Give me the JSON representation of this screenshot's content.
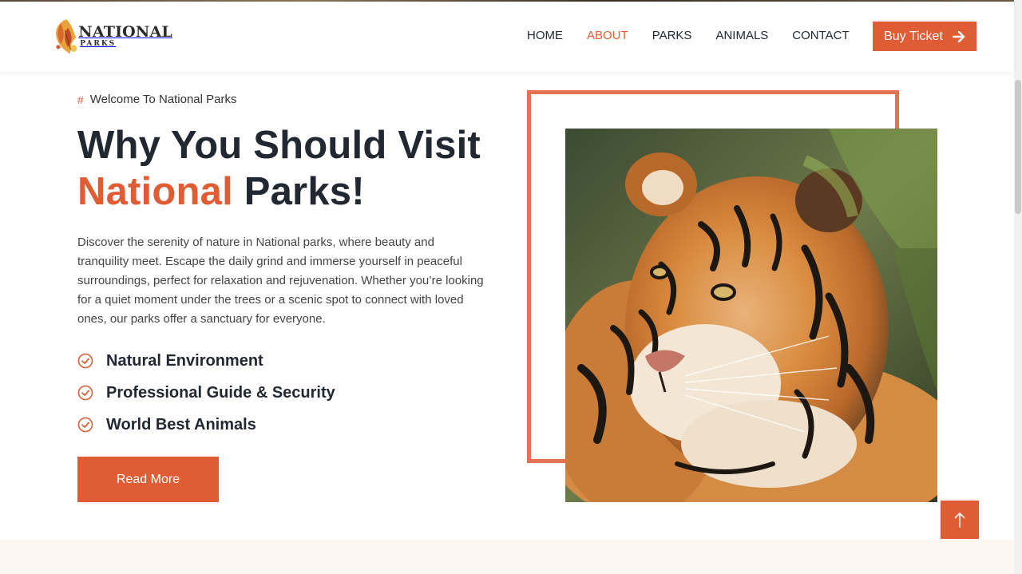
{
  "brand": {
    "title": "NATIONAL",
    "subtitle": "PARKS",
    "accent_color": "#e05c35"
  },
  "nav": {
    "items": [
      {
        "label": "HOME",
        "active": false
      },
      {
        "label": "ABOUT",
        "active": true
      },
      {
        "label": "PARKS",
        "active": false
      },
      {
        "label": "ANIMALS",
        "active": false
      },
      {
        "label": "CONTACT",
        "active": false
      }
    ],
    "cta_label": "Buy Ticket",
    "cta_icon": "arrow-right-icon"
  },
  "about": {
    "tagline_symbol": "#",
    "tagline": "Welcome To National Parks",
    "headline_line1": "Why You Should Visit",
    "headline_accent": "National",
    "headline_rest": " Parks!",
    "description": "Discover the serenity of nature in National parks, where beauty and tranquility meet. Escape the daily grind and immerse yourself in peaceful surroundings, perfect for relaxation and rejuvenation. Whether you’re looking for a quiet moment under the trees or a scenic spot to connect with loved ones, our parks offer a sanctuary for everyone.",
    "features": [
      "Natural Environment",
      "Professional Guide & Security",
      "World Best Animals"
    ],
    "button_label": "Read More"
  },
  "media": {
    "image_subject": "tiger",
    "frame_color": "#e47352"
  },
  "scroll_top": {
    "icon": "arrow-up-icon"
  }
}
